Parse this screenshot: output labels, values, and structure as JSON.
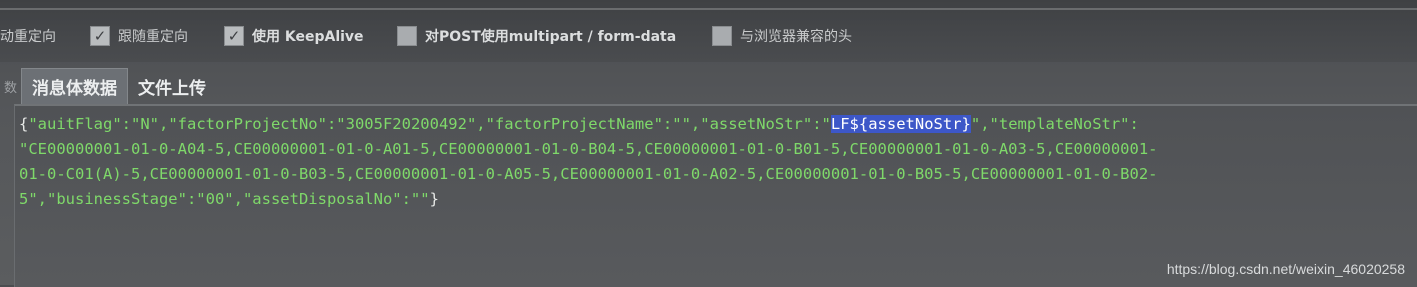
{
  "options": [
    {
      "label": "自动重定向",
      "checked": true
    },
    {
      "label": "跟随重定向",
      "checked": true
    },
    {
      "label": "使用 KeepAlive",
      "checked": true
    },
    {
      "label": "对POST使用multipart / form-data",
      "checked": false
    },
    {
      "label": "与浏览器兼容的头",
      "checked": false
    }
  ],
  "tabs": {
    "edge_label": "数",
    "items": [
      {
        "label": "消息体数据",
        "active": true
      },
      {
        "label": "文件上传",
        "active": false
      }
    ]
  },
  "body": {
    "line1": {
      "open_brace": "{",
      "before_highlight": "\"auitFlag\":\"N\",\"factorProjectNo\":\"3005F20200492\",\"factorProjectName\":\"\",\"assetNoStr\":\"",
      "highlight": "LF${assetNoStr}",
      "after_highlight": "\",\"templateNoStr\":"
    },
    "line2": "\"CE00000001-01-0-A04-5,CE00000001-01-0-A01-5,CE00000001-01-0-B04-5,CE00000001-01-0-B01-5,CE00000001-01-0-A03-5,CE00000001-",
    "line3": "01-0-C01(A)-5,CE00000001-01-0-B03-5,CE00000001-01-0-A05-5,CE00000001-01-0-A02-5,CE00000001-01-0-B05-5,CE00000001-01-0-B02-",
    "line4": {
      "text": "5\",\"businessStage\":\"00\",\"assetDisposalNo\":\"\"",
      "close_brace": "}"
    }
  },
  "watermark": "https://blog.csdn.net/weixin_46020258",
  "colors": {
    "code_text": "#7fd96a",
    "selection": "#3d57c8",
    "background": "#505255"
  }
}
